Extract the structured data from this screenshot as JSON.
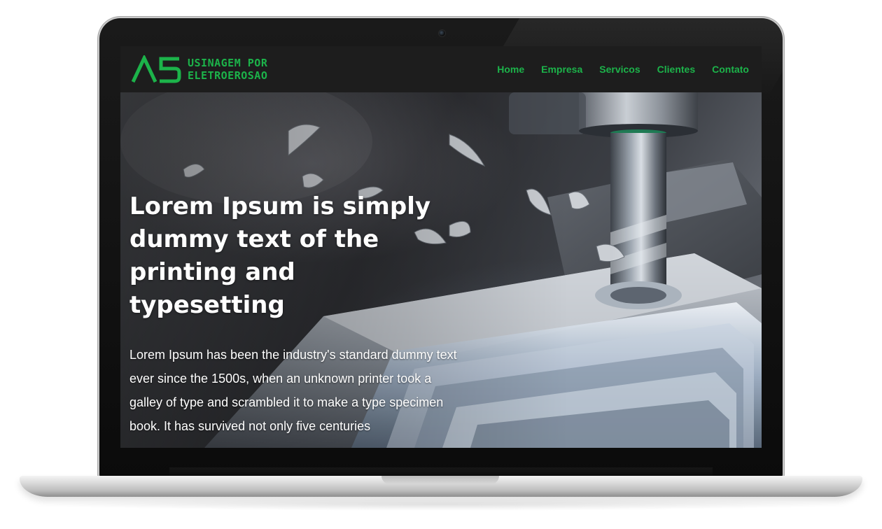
{
  "brand": {
    "logo_mark": "A5",
    "name_line1": "USINAGEM POR",
    "name_line2": "ELETROEROSAO"
  },
  "nav": {
    "items": [
      {
        "label": "Home"
      },
      {
        "label": "Empresa"
      },
      {
        "label": "Servicos"
      },
      {
        "label": "Clientes"
      },
      {
        "label": "Contato"
      }
    ]
  },
  "hero": {
    "title": "Lorem Ipsum is simply dummy text of the printing and typesetting",
    "body": "Lorem Ipsum has been the industry's standard dummy text ever since the 1500s, when an unknown printer took a galley of type and scrambled it to make a type specimen book. It has survived not only five centuries",
    "background_image": "cnc-milling-machine-photo"
  },
  "colors": {
    "accent": "#1cb34a",
    "header_bg": "#1d1d1d",
    "hero_text": "#ffffff"
  }
}
